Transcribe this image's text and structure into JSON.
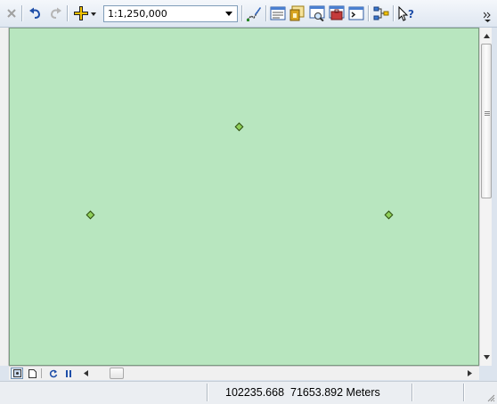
{
  "toolbar": {
    "buttons": [
      {
        "name": "close-icon",
        "enabled": false
      },
      {
        "name": "undo-icon",
        "enabled": true
      },
      {
        "name": "redo-icon",
        "enabled": false
      },
      {
        "name": "add-data-icon",
        "enabled": true
      },
      {
        "name": "editor-toolbar-icon",
        "enabled": true
      },
      {
        "name": "table-of-contents-icon",
        "enabled": true
      },
      {
        "name": "catalog-icon",
        "enabled": true
      },
      {
        "name": "search-window-icon",
        "enabled": true
      },
      {
        "name": "arctoolbox-icon",
        "enabled": true
      },
      {
        "name": "python-window-icon",
        "enabled": true
      },
      {
        "name": "model-builder-icon",
        "enabled": true
      },
      {
        "name": "whats-this-icon",
        "enabled": true
      }
    ],
    "scale": {
      "value": "1:1,250,000"
    }
  },
  "map": {
    "background": "#b8e6bf",
    "point_color": "#8fcf58"
  },
  "status": {
    "coords": "102235.668  71653.892 Meters"
  }
}
